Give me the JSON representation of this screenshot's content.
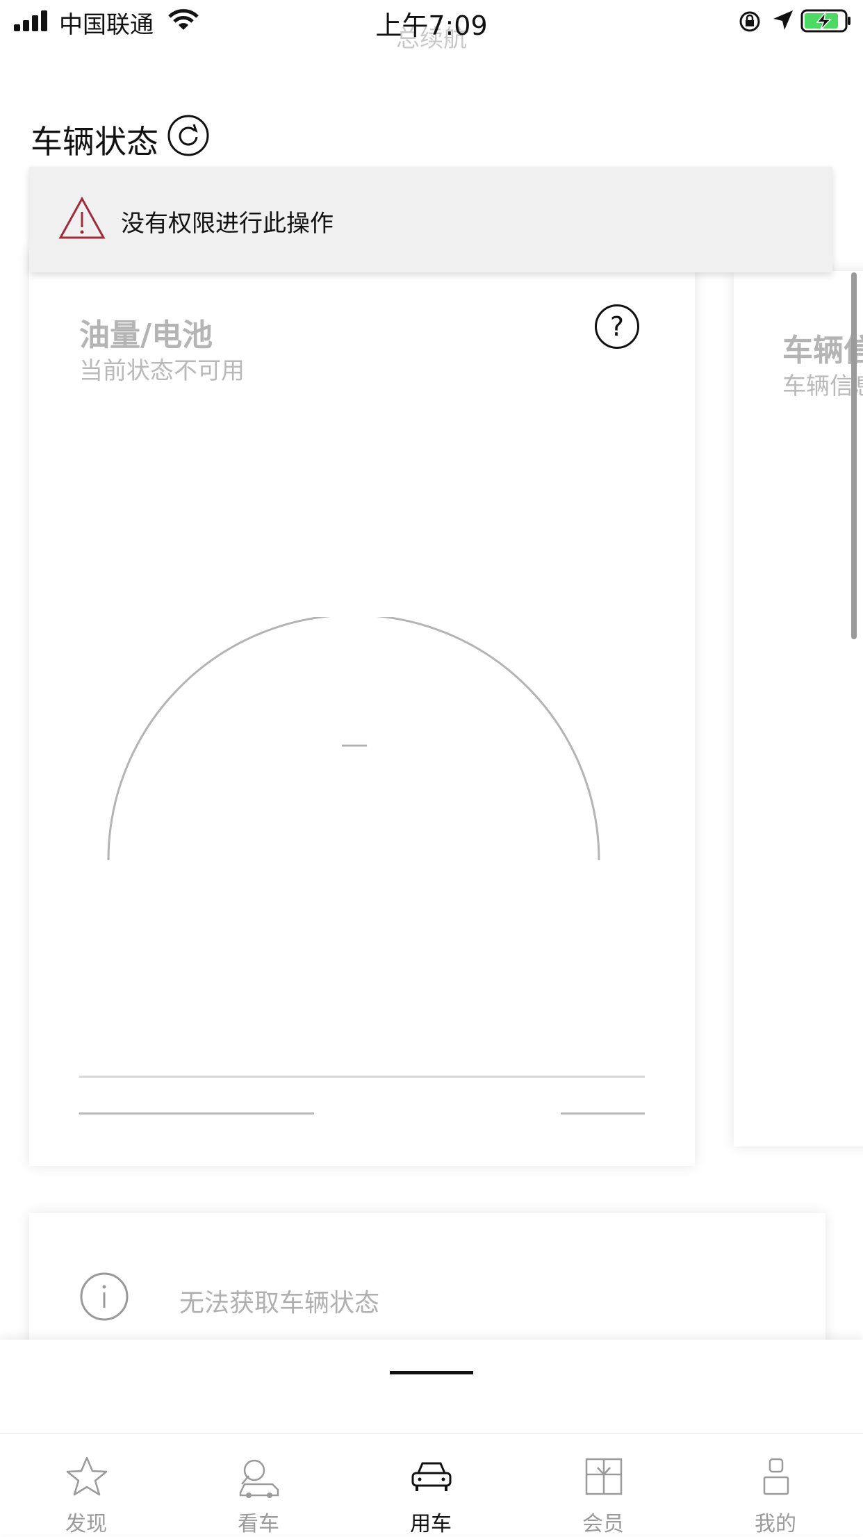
{
  "status_bar": {
    "carrier": "中国联通",
    "time": "上午7:09"
  },
  "ghost_title": "总续航",
  "section": {
    "title": "车辆状态"
  },
  "toast": {
    "message": "没有权限进行此操作"
  },
  "card_fuel": {
    "title": "油量/电池",
    "subtitle": "当前状态不可用",
    "gauge_value": "—"
  },
  "card_vehicle": {
    "title": "车辆信息",
    "subtitle": "车辆信息"
  },
  "info": {
    "message": "无法获取车辆状态"
  },
  "tabs": [
    {
      "label": "发现",
      "icon": "star-icon"
    },
    {
      "label": "看车",
      "icon": "car-search-icon"
    },
    {
      "label": "用车",
      "icon": "car-icon"
    },
    {
      "label": "会员",
      "icon": "gift-icon"
    },
    {
      "label": "我的",
      "icon": "person-icon"
    }
  ],
  "colors": {
    "warning": "#a02b3b",
    "battery_fill": "#4cd964",
    "inactive": "#9a9a9a"
  }
}
